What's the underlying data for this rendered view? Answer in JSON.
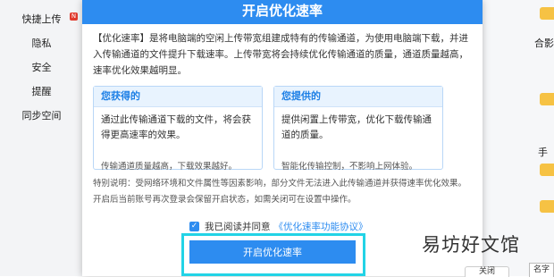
{
  "sidebar": {
    "items": [
      {
        "label": "快捷上传",
        "badge": "N"
      },
      {
        "label": "隐私"
      },
      {
        "label": "安全"
      },
      {
        "label": "提醒"
      },
      {
        "label": "同步空间"
      }
    ]
  },
  "right_panel": {
    "frag1": "合影",
    "frag2": "手",
    "corner_frag": "名字",
    "close_frag": "关闭"
  },
  "dialog": {
    "title": "开启优化速率",
    "intro": "【优化速率】是将电脑端的空闲上传带宽组建成特有的传输通道，为使用电脑端下载，并进入传输通道的文件提升下载速率。上传带宽将会持续优化传输通道的质量，通道质量越高，速率优化效果越明显。",
    "card_get": {
      "title": "您获得的",
      "body": "通过此传输通道下载的文件，将会获得更高速率的效果。",
      "foot": "传输通道质量越高，下载效果越好。"
    },
    "card_give": {
      "title": "您提供的",
      "body": "提供闲置上传带宽，优化下载传输通道的质量。",
      "foot": "智能化传输控制，不影响上网体验。"
    },
    "note": "特别说明：受网络环境和文件属性等因素影响，部分文件无法进入此传输通道并获得速率优化效果。开启后当前账号再次登录会保留开启状态，如需关闭可在设置中操作。",
    "agree_label": "我已阅读并同意",
    "agree_link": "《优化速率功能协议》",
    "confirm_label": "开启优化速率"
  },
  "watermark": "易坊好文馆",
  "colors": {
    "accent": "#2d8cf0",
    "highlight": "#22d3e6",
    "badge": "#e23b2e"
  }
}
